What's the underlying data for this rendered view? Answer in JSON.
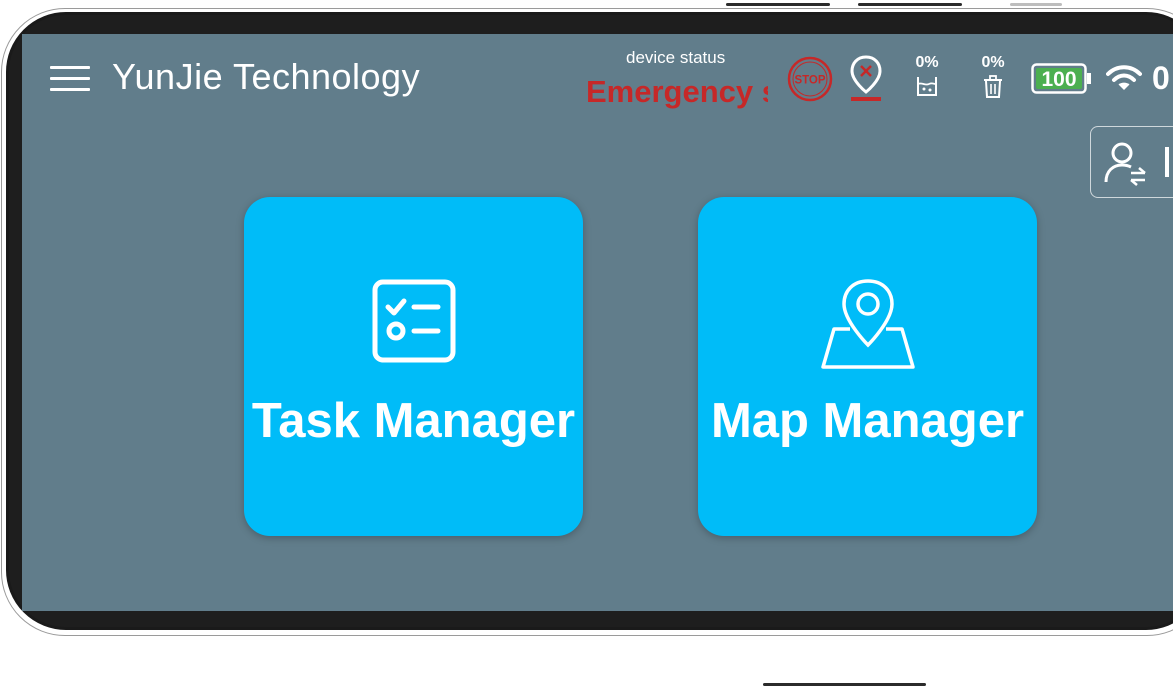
{
  "header": {
    "title": "YunJie Technology",
    "device_status_label": "device status",
    "device_status_value": "Emergency s"
  },
  "indicators": {
    "water_level": "0%",
    "trash_level": "0%",
    "battery": "100",
    "wifi_value": "0"
  },
  "cards": {
    "task_manager_label": "Task Manager",
    "map_manager_label": "Map Manager"
  },
  "stop_label": "STOP",
  "colors": {
    "screen_bg": "#617d8b",
    "card_bg": "#00bcf8",
    "alert_red": "#c62828",
    "battery_green": "#4caf50"
  },
  "icons": [
    "menu-icon",
    "stop-icon",
    "location-error-icon",
    "water-tank-icon",
    "trash-icon",
    "battery-icon",
    "wifi-icon",
    "user-switch-icon",
    "checklist-icon",
    "map-pin-icon"
  ]
}
